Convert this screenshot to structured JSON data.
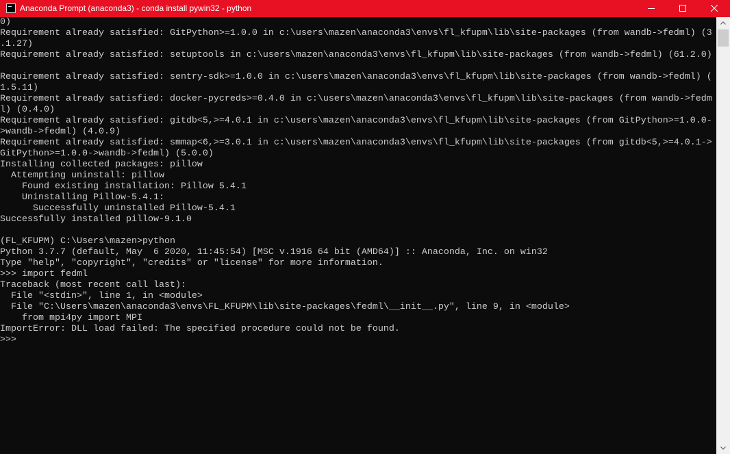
{
  "window": {
    "title": "Anaconda Prompt (anaconda3) - conda  install pywin32 - python",
    "colors": {
      "titlebar": "#e81123",
      "console_bg": "#0c0c0c",
      "console_text": "#cccccc",
      "scrollbar_track": "#f0f0f0",
      "scrollbar_thumb": "#cdcdcd"
    },
    "controls": {
      "minimize_icon": "minimize-icon",
      "maximize_icon": "maximize-icon",
      "close_icon": "close-icon"
    }
  },
  "console": {
    "lines": [
      "0)",
      "Requirement already satisfied: GitPython>=1.0.0 in c:\\users\\mazen\\anaconda3\\envs\\fl_kfupm\\lib\\site-packages (from wandb->fedml) (3",
      ".1.27)",
      "Requirement already satisfied: setuptools in c:\\users\\mazen\\anaconda3\\envs\\fl_kfupm\\lib\\site-packages (from wandb->fedml) (61.2.0)",
      "",
      "Requirement already satisfied: sentry-sdk>=1.0.0 in c:\\users\\mazen\\anaconda3\\envs\\fl_kfupm\\lib\\site-packages (from wandb->fedml) (",
      "1.5.11)",
      "Requirement already satisfied: docker-pycreds>=0.4.0 in c:\\users\\mazen\\anaconda3\\envs\\fl_kfupm\\lib\\site-packages (from wandb->fedm",
      "l) (0.4.0)",
      "Requirement already satisfied: gitdb<5,>=4.0.1 in c:\\users\\mazen\\anaconda3\\envs\\fl_kfupm\\lib\\site-packages (from GitPython>=1.0.0-",
      ">wandb->fedml) (4.0.9)",
      "Requirement already satisfied: smmap<6,>=3.0.1 in c:\\users\\mazen\\anaconda3\\envs\\fl_kfupm\\lib\\site-packages (from gitdb<5,>=4.0.1->",
      "GitPython>=1.0.0->wandb->fedml) (5.0.0)",
      "Installing collected packages: pillow",
      "  Attempting uninstall: pillow",
      "    Found existing installation: Pillow 5.4.1",
      "    Uninstalling Pillow-5.4.1:",
      "      Successfully uninstalled Pillow-5.4.1",
      "Successfully installed pillow-9.1.0",
      "",
      "(FL_KFUPM) C:\\Users\\mazen>python",
      "Python 3.7.7 (default, May  6 2020, 11:45:54) [MSC v.1916 64 bit (AMD64)] :: Anaconda, Inc. on win32",
      "Type \"help\", \"copyright\", \"credits\" or \"license\" for more information.",
      ">>> import fedml",
      "Traceback (most recent call last):",
      "  File \"<stdin>\", line 1, in <module>",
      "  File \"C:\\Users\\mazen\\anaconda3\\envs\\FL_KFUPM\\lib\\site-packages\\fedml\\__init__.py\", line 9, in <module>",
      "    from mpi4py import MPI",
      "ImportError: DLL load failed: The specified procedure could not be found.",
      ">>>"
    ]
  },
  "scrollbar": {
    "up_icon": "scroll-up-arrow-icon",
    "down_icon": "scroll-down-arrow-icon"
  }
}
